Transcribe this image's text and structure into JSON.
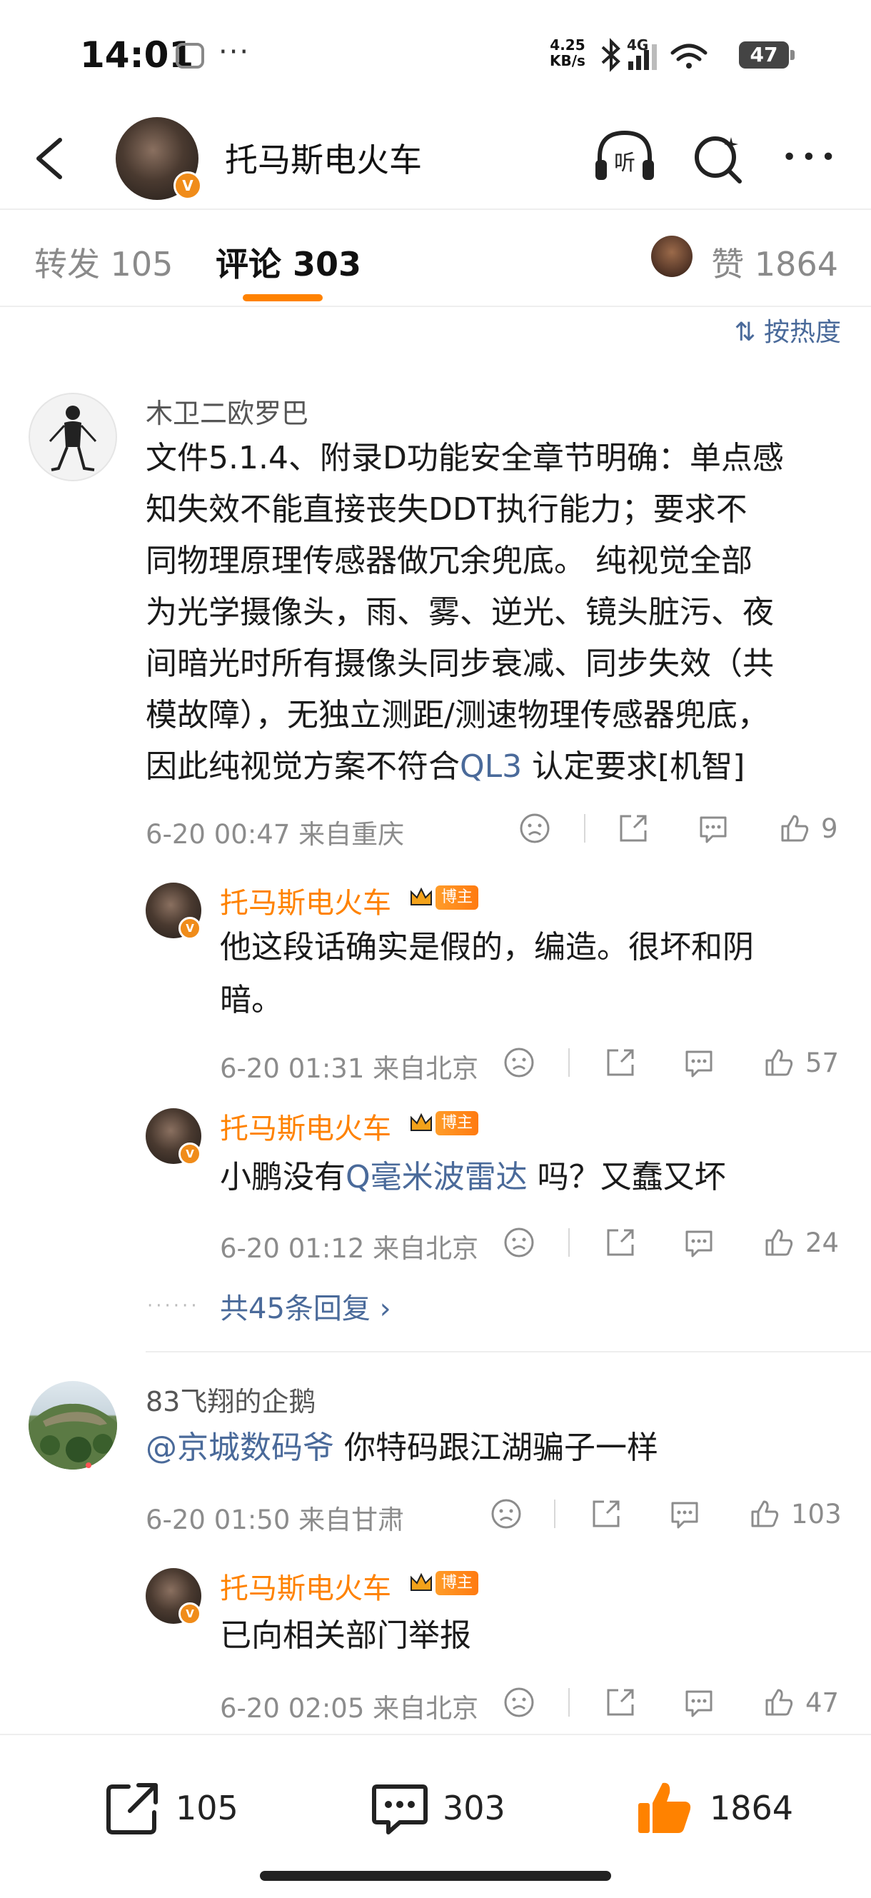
{
  "status_bar": {
    "time": "14:01",
    "speed_value": "4.25",
    "speed_unit": "KB/s",
    "network": "4G",
    "battery": "47"
  },
  "header": {
    "title": "托马斯电火车",
    "listen_label": "听"
  },
  "tabs": {
    "repost": "转发 105",
    "comment": "评论 303",
    "like": "赞 1864"
  },
  "sort_label": "按热度",
  "comments": [
    {
      "user": "木卫二欧罗巴",
      "text_lines": [
        "文件5.1.4、附录D功能安全章节明确：单点感",
        "知失效不能直接丧失DDT执行能力；要求不",
        "同物理原理传感器做冗余兜底。 纯视觉全部",
        "为光学摄像头，雨、雾、逆光、镜头脏污、夜",
        "间暗光时所有摄像头同步衰减、同步失效（共",
        "模故障），无独立测距/测速物理传感器兜底，"
      ],
      "text_last_prefix": "因此纯视觉方案不符合",
      "text_last_link": "L3",
      "text_last_suffix": " 认定要求[机智]",
      "time": "6-20 00:47",
      "location": "来自重庆",
      "likes": "9",
      "replies": [
        {
          "user": "托马斯电火车",
          "badge": "博主",
          "text_line1": "他这段话确实是假的，编造。很坏和阴",
          "text_line2": "暗。",
          "time": "6-20 01:31",
          "location": "来自北京",
          "likes": "57"
        },
        {
          "user": "托马斯电火车",
          "badge": "博主",
          "text_prefix": "小鹏没有",
          "text_link": "毫米波雷达",
          "text_suffix": " 吗？又蠢又坏",
          "time": "6-20 01:12",
          "location": "来自北京",
          "likes": "24"
        }
      ],
      "more_replies": "共45条回复"
    },
    {
      "user": "83飞翔的企鹅",
      "mention": "@京城数码爷",
      "text": " 你特码跟江湖骗子一样",
      "time": "6-20 01:50",
      "location": "来自甘肃",
      "likes": "103",
      "reply": {
        "user": "托马斯电火车",
        "badge": "博主",
        "text": "已向相关部门举报",
        "time": "6-20 02:05",
        "location": "来自北京",
        "likes": "47"
      }
    }
  ],
  "bottom_bar": {
    "repost_count": "105",
    "comment_count": "303",
    "like_count": "1864"
  },
  "colors": {
    "accent_orange": "#ff8200",
    "link_blue": "#4a6a9a",
    "meta_gray": "#8c8c8c"
  }
}
